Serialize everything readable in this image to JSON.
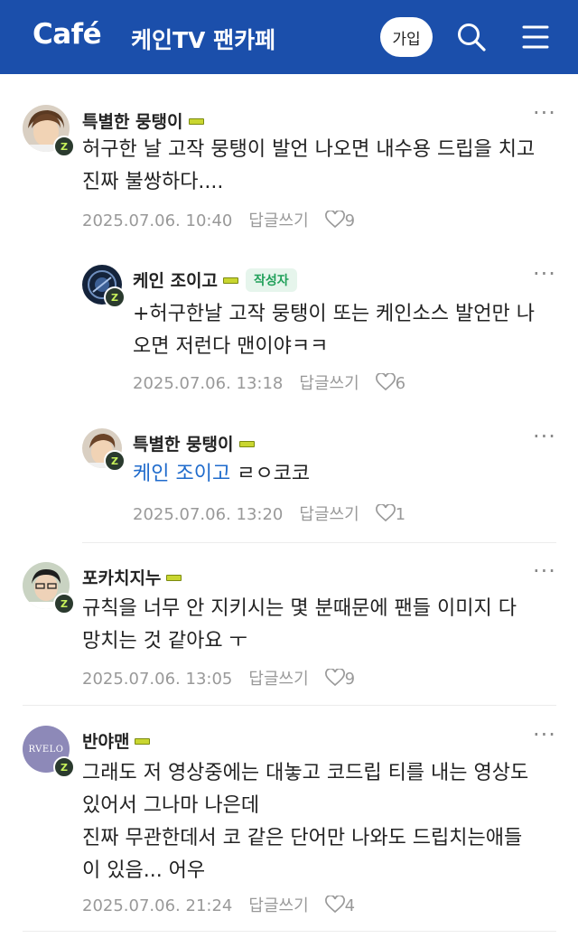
{
  "header": {
    "logo": "Café",
    "cafe_name": "케인TV 팬카페",
    "join_label": "가입"
  },
  "badge_glyph": "Z",
  "colors": {
    "header_bg": "#1b4fab",
    "mention": "#1f6bcc",
    "author_tag": "#21a05a"
  },
  "comments": [
    {
      "nickname": "특별한 뭉탱이",
      "lines": [
        "허구한 날 고작 뭉탱이 발언 나오면 내수용 드립을 치고",
        "진짜 불쌍하다...."
      ],
      "timestamp": "2025.07.06. 10:40",
      "reply_label": "답글쓰기",
      "likes": "9"
    },
    {
      "nickname": "케인 조이고",
      "author_tag": "작성자",
      "lines": [
        "+허구한날 고작 뭉탱이 또는 케인소스 발언만 나",
        "오면 저런다 맨이야ㅋㅋ"
      ],
      "timestamp": "2025.07.06. 13:18",
      "reply_label": "답글쓰기",
      "likes": "6"
    },
    {
      "nickname": "특별한 뭉탱이",
      "mention": "케인 조이고",
      "text": "ㄹㅇ코코",
      "timestamp": "2025.07.06. 13:20",
      "reply_label": "답글쓰기",
      "likes": "1"
    },
    {
      "nickname": "포카치지누",
      "lines": [
        "규칙을 너무 안 지키시는 몇 분때문에 팬들 이미지 다",
        "망치는 것 같아요 ㅜ"
      ],
      "timestamp": "2025.07.06. 13:05",
      "reply_label": "답글쓰기",
      "likes": "9"
    },
    {
      "nickname": "반야맨",
      "avatar_text": "RVELO",
      "lines": [
        "그래도 저 영상중에는 대놓고 코드립 티를 내는 영상도",
        "있어서 그나마 나은데",
        "진짜 무관한데서 코 같은 단어만 나와도 드립치는애들",
        "이 있음... 어우"
      ],
      "timestamp": "2025.07.06. 21:24",
      "reply_label": "답글쓰기",
      "likes": "4"
    }
  ]
}
